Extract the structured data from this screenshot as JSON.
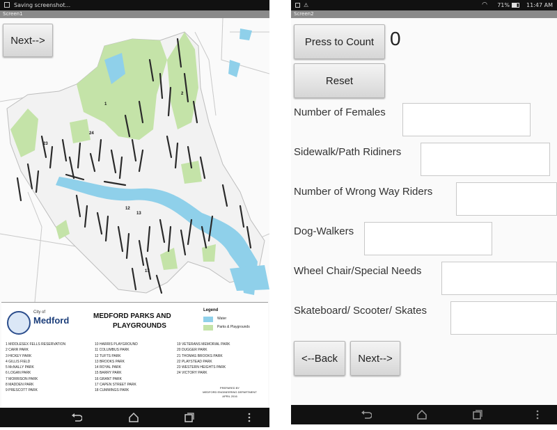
{
  "left_screen": {
    "status_text": "Saving screenshot...",
    "screen_title": "Screen1",
    "next_button": "Next-->",
    "map": {
      "title_line1": "MEDFORD PARKS AND",
      "title_line2": "PLAYGROUNDS",
      "seal_city_of": "City of",
      "seal_city": "Medford",
      "legend_title": "Legend",
      "legend_water": "Water",
      "legend_parks": "Parks & Playgrounds",
      "credits_line1": "PREPARED BY",
      "credits_line2": "MEDFORD ENGINEERING DEPARTMENT",
      "credits_line3": "APRIL 2016",
      "parks_col1": [
        "1  MIDDLESEX FELLS RESERVATION",
        "2  CARR PARK",
        "3  HICKEY PARK",
        "4  GILLIS FIELD",
        "5  McNALLY PARK",
        "6  LOGAN PARK",
        "7  MORRISON PARK",
        "8  MADDEN PARK",
        "9  PRESCOTT PARK"
      ],
      "parks_col2": [
        "10  HARRIS PLAYGROUND",
        "11  COLUMBUS PARK",
        "12  TUFTS PARK",
        "13  BROOKS PARK",
        "14  ROYAL PARK",
        "15  BARRY PARK",
        "16  GRANT PARK",
        "17  CAPEN STREET PARK",
        "18  CUMMINGS PARK"
      ],
      "parks_col3": [
        "19  VETERANS MEMORIAL PARK",
        "20  DUGGER PARK",
        "21  THOMAS BROOKS PARK",
        "22  PLAYSTEAD PARK",
        "23  WESTERN HEIGHTS PARK",
        "24  VICTORY PARK"
      ]
    }
  },
  "right_screen": {
    "status_battery": "71%",
    "status_time": "11:47 AM",
    "screen_title": "Screen2",
    "count_button": "Press to Count",
    "count_value": "0",
    "reset_button": "Reset",
    "fields": [
      {
        "label": "Number of Females",
        "value": ""
      },
      {
        "label": "Sidewalk/Path Ridiners",
        "value": ""
      },
      {
        "label": "Number of Wrong Way Riders",
        "value": ""
      },
      {
        "label": "Dog-Walkers",
        "value": ""
      },
      {
        "label": "Wheel Chair/Special Needs",
        "value": ""
      },
      {
        "label": "Skateboard/ Scooter/ Skates",
        "value": ""
      }
    ],
    "back_button": "<--Back",
    "next_button": "Next-->"
  },
  "colors": {
    "water": "#8fd0ea",
    "parks": "#c4e3a8",
    "streets": "#2a2a2a",
    "nav_bar": "#111111",
    "title_bar": "#8a8a8a",
    "button_face": "#e2e2e2"
  },
  "icons": [
    "notification-icon",
    "back-nav-icon",
    "home-nav-icon",
    "recents-nav-icon",
    "menu-nav-icon",
    "wifi-icon",
    "battery-icon",
    "alert-icon"
  ]
}
